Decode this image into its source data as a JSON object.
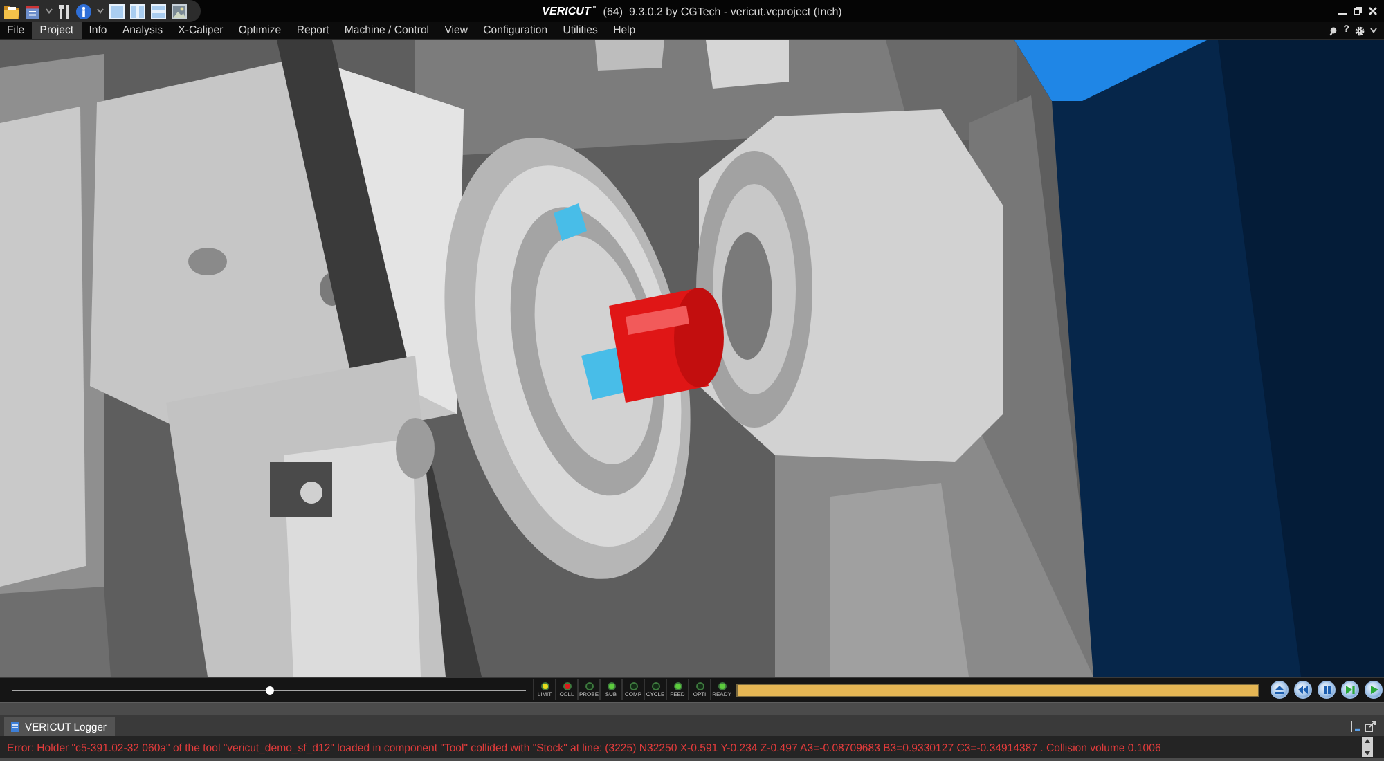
{
  "window": {
    "logo": "VERICUT$^{™}$",
    "title": "(64)  9.3.0.2 by CGTech - vericut.vcproject (Inch)"
  },
  "menu": [
    {
      "label": "File",
      "selected": false
    },
    {
      "label": "Project",
      "selected": true
    },
    {
      "label": "Info",
      "selected": false
    },
    {
      "label": "Analysis",
      "selected": false
    },
    {
      "label": "X-Caliper",
      "selected": false
    },
    {
      "label": "Optimize",
      "selected": false
    },
    {
      "label": "Report",
      "selected": false
    },
    {
      "label": "Machine / Control",
      "selected": false
    },
    {
      "label": "View",
      "selected": false
    },
    {
      "label": "Configuration",
      "selected": false
    },
    {
      "label": "Utilities",
      "selected": false
    },
    {
      "label": "Help",
      "selected": false
    }
  ],
  "menu_tools": {
    "help": "?"
  },
  "playback": {
    "position": {
      "level": 0.5
    },
    "lights": [
      {
        "label": "LIMIT",
        "color": "#e8dc1c"
      },
      {
        "label": "COLL",
        "color": "#d81c1c"
      },
      {
        "label": "PROBE",
        "color": "#132a16"
      },
      {
        "label": "SUB",
        "color": "#5ccc3c"
      },
      {
        "label": "COMP",
        "color": "#132a16"
      },
      {
        "label": "CYCLE",
        "color": "#132a16"
      },
      {
        "label": "FEED",
        "color": "#5ccc3c"
      },
      {
        "label": "OPTI",
        "color": "#132a16"
      },
      {
        "label": "READY",
        "color": "#5ccc3c"
      }
    ],
    "progress": {
      "level": 1
    }
  },
  "logger": {
    "tab": {
      "label": "VERICUT Logger",
      "selected": true
    },
    "messages": [
      {
        "kind": "error",
        "text": "Error: Holder \"c5-391.02-32 060a\" of the tool \"vericut_demo_sf_d12\" loaded in component \"Tool\" collided with \"Stock\" at line: (3225) N32250 X-0.591 Y-0.234 Z-0.497 A3=-0.08709683 B3=0.9330127 C3=-0.34914387 . Collision volume 0.1006"
      }
    ]
  }
}
